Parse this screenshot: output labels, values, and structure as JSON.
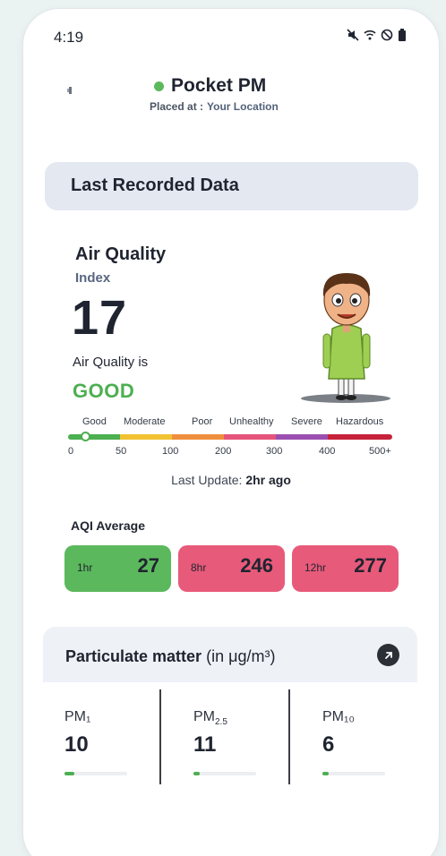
{
  "status_bar": {
    "time": "4:19"
  },
  "header": {
    "device_name": "Pocket PM",
    "placed_at_label": "Placed at :",
    "placed_at_value": "Your Location"
  },
  "recorded": {
    "title": "Last Recorded Data"
  },
  "aqi": {
    "label": "Air Quality",
    "sublabel": "Index",
    "value": "17",
    "is_label": "Air Quality is",
    "status": "GOOD",
    "status_color": "#4caf50",
    "marker_value": 17,
    "scale_labels": [
      "Good",
      "Moderate",
      "Poor",
      "Unhealthy",
      "Severe",
      "Hazardous"
    ],
    "scale_ticks": [
      "0",
      "50",
      "100",
      "200",
      "300",
      "400",
      "500+"
    ],
    "scale_colors": [
      "#4caf50",
      "#f1c232",
      "#ef8f3d",
      "#e5557b",
      "#9b4fb0",
      "#c6233b"
    ],
    "last_update_label": "Last Update:",
    "last_update_value": "2hr ago"
  },
  "average": {
    "title": "AQI Average",
    "cards": [
      {
        "period": "1hr",
        "value": "27",
        "color": "#5cb85c"
      },
      {
        "period": "8hr",
        "value": "246",
        "color": "#e85a7a"
      },
      {
        "period": "12hr",
        "value": "277",
        "color": "#e85a7a"
      }
    ]
  },
  "particulate": {
    "title": "Particulate matter",
    "unit": "(in μg/m³)",
    "items": [
      {
        "label": "PM₁",
        "value": "10",
        "level": 0.16
      },
      {
        "label_main": "PM",
        "label_sub": "2.5",
        "value": "11",
        "level": 0.1
      },
      {
        "label": "PM₁₀",
        "value": "6",
        "level": 0.1
      }
    ]
  }
}
